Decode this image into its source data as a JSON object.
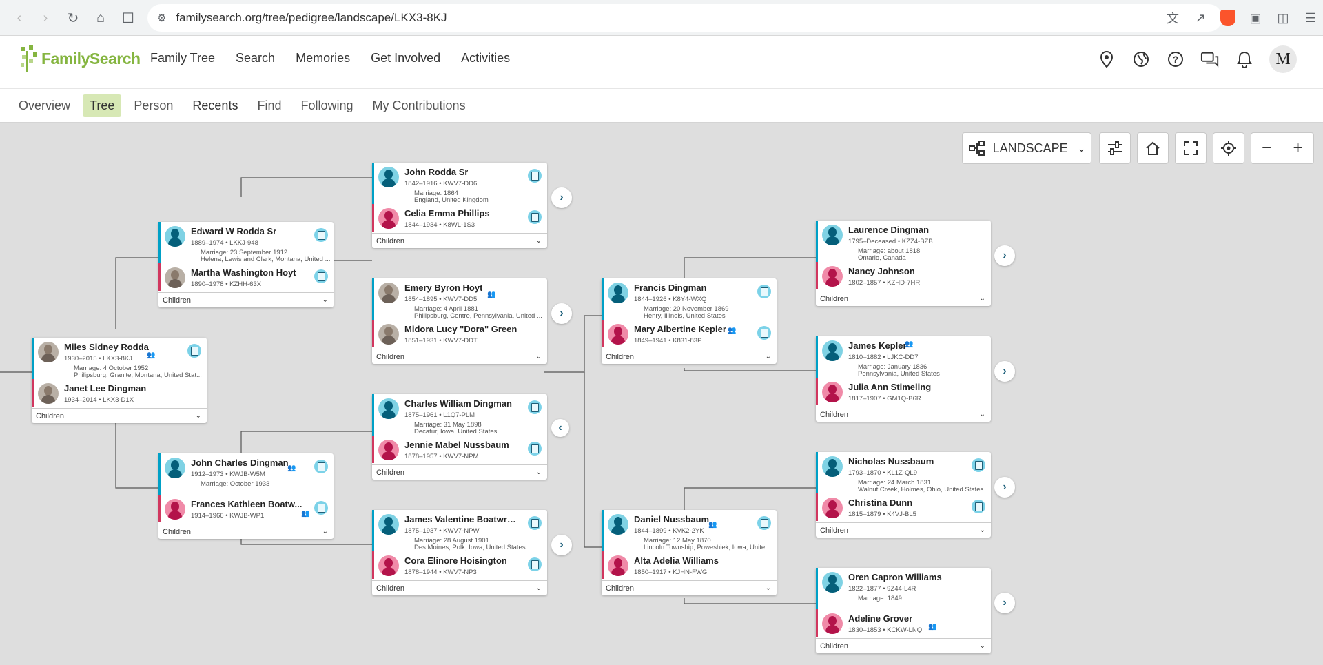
{
  "browser": {
    "url": "familysearch.org/tree/pedigree/landscape/LKX3-8KJ"
  },
  "header": {
    "logo_text": "FamilySearch",
    "nav": [
      "Family Tree",
      "Search",
      "Memories",
      "Get Involved",
      "Activities"
    ],
    "avatar_letter": "M"
  },
  "subnav": [
    "Overview",
    "Tree",
    "Person",
    "Recents",
    "Find",
    "Following",
    "My Contributions"
  ],
  "toolbar": {
    "view_label": "LANDSCAPE"
  },
  "children_label": "Children",
  "cards": [
    {
      "husband": {
        "name": "Miles Sidney Rodda",
        "meta": "1930–2015 • LKX3-8KJ"
      },
      "marriage": [
        "Marriage: 4 October 1952",
        "Philipsburg, Granite, Montana, United Stat..."
      ],
      "wife": {
        "name": "Janet Lee Dingman",
        "meta": "1934–2014 • LKX3-D1X"
      }
    },
    {
      "husband": {
        "name": "Edward W Rodda Sr",
        "meta": "1889–1974 • LKKJ-948"
      },
      "marriage": [
        "Marriage: 23 September 1912",
        "Helena, Lewis and Clark, Montana, United ..."
      ],
      "wife": {
        "name": "Martha Washington Hoyt",
        "meta": "1890–1978 • KZHH-63X"
      }
    },
    {
      "husband": {
        "name": "John Charles Dingman",
        "meta": "1912–1973 • KWJB-W5M"
      },
      "marriage": [
        "Marriage: October 1933",
        ""
      ],
      "wife": {
        "name": "Frances Kathleen Boatw...",
        "meta": "1914–1966 • KWJB-WP1"
      }
    },
    {
      "husband": {
        "name": "John Rodda Sr",
        "meta": "1842–1916 • KWV7-DD6"
      },
      "marriage": [
        "Marriage: 1864",
        "England, United Kingdom"
      ],
      "wife": {
        "name": "Celia Emma Phillips",
        "meta": "1844–1934 • K8WL-1S3"
      }
    },
    {
      "husband": {
        "name": "Emery Byron Hoyt",
        "meta": "1854–1895 • KWV7-DD5"
      },
      "marriage": [
        "Marriage: 4 April 1881",
        "Philipsburg, Centre, Pennsylvania, United ..."
      ],
      "wife": {
        "name": "Midora Lucy \"Dora\" Green",
        "meta": "1851–1931 • KWV7-DDT"
      }
    },
    {
      "husband": {
        "name": "Charles William Dingman",
        "meta": "1875–1961 • L1Q7-PLM"
      },
      "marriage": [
        "Marriage: 31 May 1898",
        "Decatur, Iowa, United States"
      ],
      "wife": {
        "name": "Jennie Mabel Nussbaum",
        "meta": "1878–1957 • KWV7-NPM"
      }
    },
    {
      "husband": {
        "name": "James Valentine Boatwright",
        "meta": "1875–1937 • KWV7-NPW"
      },
      "marriage": [
        "Marriage: 28 August 1901",
        "Des Moines, Polk, Iowa, United States"
      ],
      "wife": {
        "name": "Cora Elinore Hoisington",
        "meta": "1878–1944 • KWV7-NP3"
      }
    },
    {
      "husband": {
        "name": "Francis Dingman",
        "meta": "1844–1926 • K8Y4-WXQ"
      },
      "marriage": [
        "Marriage: 20 November 1869",
        "Henry, Illinois, United States"
      ],
      "wife": {
        "name": "Mary Albertine Kepler",
        "meta": "1849–1941 • K831-83P"
      }
    },
    {
      "husband": {
        "name": "Daniel Nussbaum",
        "meta": "1844–1899 • KVK2-2YK"
      },
      "marriage": [
        "Marriage: 12 May 1870",
        "Lincoln Township, Poweshiek, Iowa, Unite..."
      ],
      "wife": {
        "name": "Alta Adelia Williams",
        "meta": "1850–1917 • KJHN-FWG"
      }
    },
    {
      "husband": {
        "name": "Laurence Dingman",
        "meta": "1795–Deceased • KZZ4-BZB"
      },
      "marriage": [
        "Marriage: about 1818",
        "Ontario, Canada"
      ],
      "wife": {
        "name": "Nancy Johnson",
        "meta": "1802–1857 • KZHD-7HR"
      }
    },
    {
      "husband": {
        "name": "James Kepler",
        "meta": "1810–1882 • LJKC-DD7"
      },
      "marriage": [
        "Marriage: January 1836",
        "Pennsylvania, United States"
      ],
      "wife": {
        "name": "Julia Ann Stimeling",
        "meta": "1817–1907 • GM1Q-B6R"
      }
    },
    {
      "husband": {
        "name": "Nicholas Nussbaum",
        "meta": "1793–1870 • KL1Z-QL9"
      },
      "marriage": [
        "Marriage: 24 March 1831",
        "Walnut Creek, Holmes, Ohio, United States"
      ],
      "wife": {
        "name": "Christina Dunn",
        "meta": "1815–1879 • K4VJ-BL5"
      }
    },
    {
      "husband": {
        "name": "Oren Capron Williams",
        "meta": "1822–1877 • 9Z44-L4R"
      },
      "marriage": [
        "Marriage: 1849",
        ""
      ],
      "wife": {
        "name": "Adeline Grover",
        "meta": "1830–1853 • KCKW-LNQ"
      }
    }
  ]
}
